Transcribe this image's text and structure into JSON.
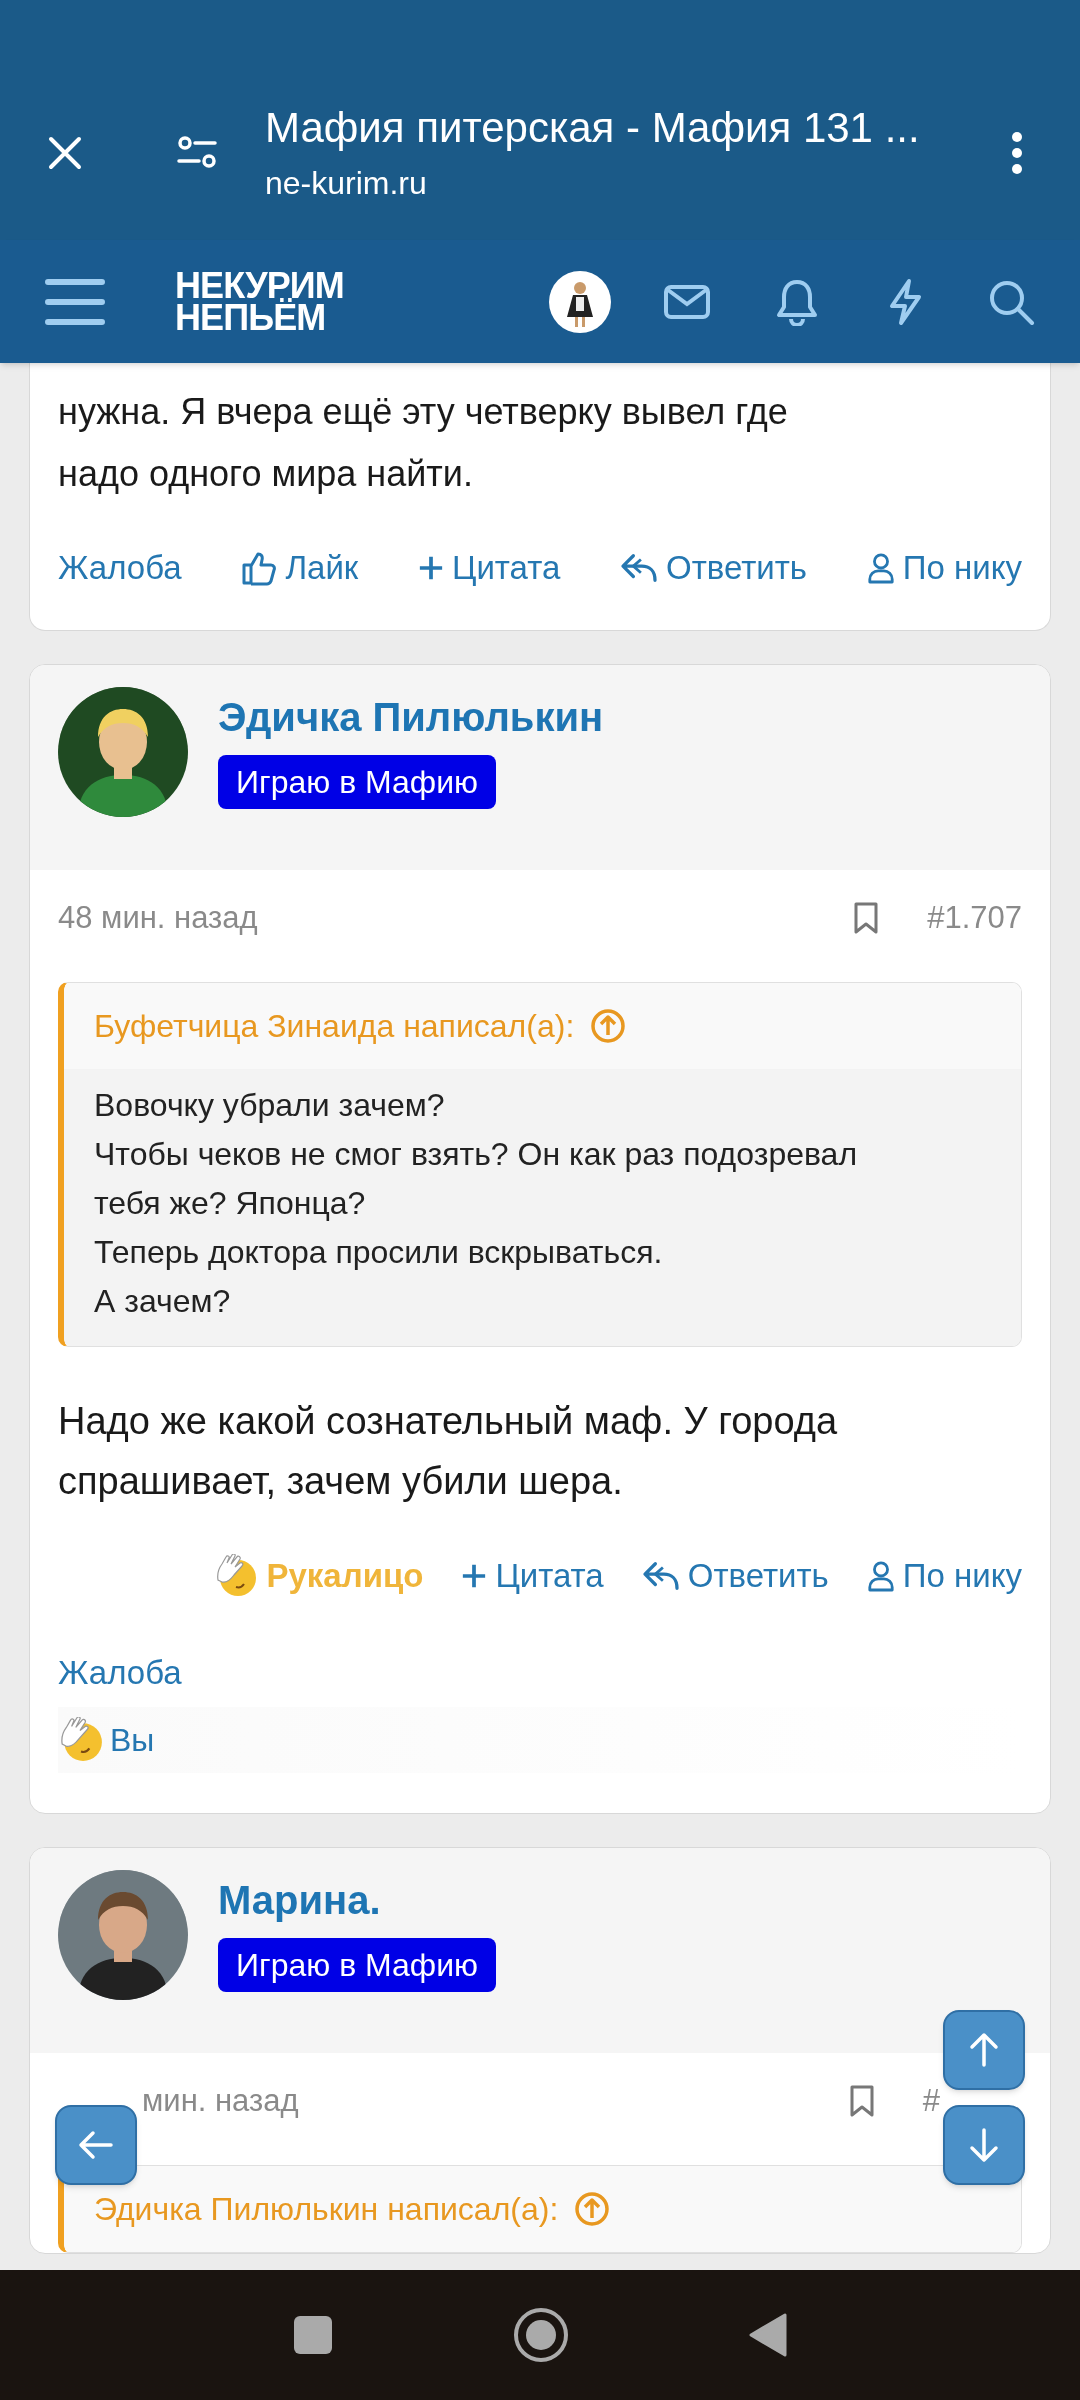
{
  "browser_bar": {
    "title": "Мафия питерская - Мафия 131 ...",
    "url": "ne-kurim.ru"
  },
  "site_header": {
    "logo": [
      "НЕКУРИМ",
      "НЕПЬЁМ"
    ]
  },
  "posts": [
    {
      "kind": "partial",
      "body": [
        "нужна. Я вчера ещё эту четверку вывел где",
        "надо одного мира найти."
      ],
      "actions": [
        {
          "kind": "report",
          "label": "Жалоба"
        },
        {
          "kind": "like",
          "label": "Лайк"
        },
        {
          "kind": "quote",
          "label": "Цитата"
        },
        {
          "kind": "reply",
          "label": "Ответить"
        },
        {
          "kind": "by_nick",
          "label": "По нику"
        }
      ]
    },
    {
      "kind": "full",
      "author": "Эдичка Пилюлькин",
      "badge": "Играю в Мафию",
      "time": "48 мин. назад",
      "number": "#1.707",
      "quote": {
        "author": "Буфетчица Зинаида написал(а):",
        "lines": [
          "Вовочку убрали зачем?",
          "Чтобы чеков не смог взять? Он как раз подозревал",
          "тебя же? Японца?",
          "Теперь доктора просили вскрываться.",
          "А зачем?"
        ]
      },
      "body": [
        "Надо же какой сознательный маф. У города",
        "спрашивает, зачем убили шера."
      ],
      "actions": [
        {
          "kind": "reaction",
          "label": "Рукалицо"
        },
        {
          "kind": "quote",
          "label": "Цитата"
        },
        {
          "kind": "reply",
          "label": "Ответить"
        },
        {
          "kind": "by_nick",
          "label": "По нику"
        }
      ],
      "report": "Жалоба",
      "reactions": "Вы"
    },
    {
      "kind": "full",
      "author": "Марина.",
      "badge": "Играю в Мафию",
      "time": "мин. назад",
      "number": "#",
      "quote": {
        "author": "Эдичка Пилюлькин написал(а):"
      }
    }
  ]
}
